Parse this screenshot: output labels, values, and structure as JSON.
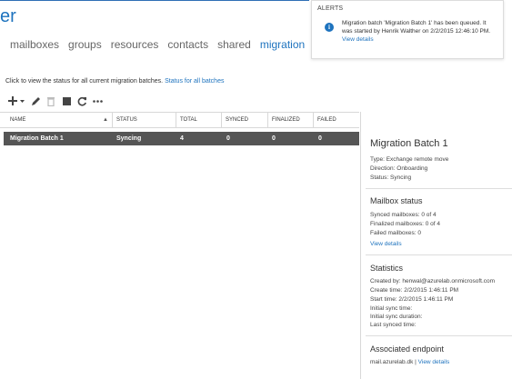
{
  "app": {
    "title": "er"
  },
  "nav": {
    "items": [
      {
        "label": "mailboxes",
        "active": false
      },
      {
        "label": "groups",
        "active": false
      },
      {
        "label": "resources",
        "active": false
      },
      {
        "label": "contacts",
        "active": false
      },
      {
        "label": "shared",
        "active": false
      },
      {
        "label": "migration",
        "active": true
      }
    ]
  },
  "alerts": {
    "title": "ALERTS",
    "message": "Migration batch 'Migration Batch 1' has been queued. It was started by Henrik Walther on 2/2/2015 12:46:10 PM.",
    "link": "View details",
    "icon": "info-icon"
  },
  "instruction": {
    "text": "Click to view the status for all current migration batches.",
    "link": "Status for all batches"
  },
  "toolbar": {
    "buttons": [
      {
        "name": "add-icon",
        "label": "New"
      },
      {
        "name": "edit-icon",
        "label": "Edit"
      },
      {
        "name": "delete-icon",
        "label": "Delete"
      },
      {
        "name": "stop-icon",
        "label": "Stop"
      },
      {
        "name": "refresh-icon",
        "label": "Refresh"
      },
      {
        "name": "more-icon",
        "label": "More options"
      }
    ]
  },
  "grid": {
    "columns": [
      "NAME",
      "STATUS",
      "TOTAL",
      "SYNCED",
      "FINALIZED",
      "FAILED"
    ],
    "sort_column": "NAME",
    "sort_direction": "ascending",
    "rows": [
      {
        "name": "Migration Batch 1",
        "status": "Syncing",
        "total": "4",
        "synced": "0",
        "finalized": "0",
        "failed": "0"
      }
    ]
  },
  "details": {
    "title": "Migration Batch 1",
    "type": "Type: Exchange remote move",
    "direction": "Direction: Onboarding",
    "status": "Status: Syncing",
    "mailbox_status": {
      "heading": "Mailbox status",
      "synced": "Synced mailboxes: 0 of 4",
      "finalized": "Finalized mailboxes: 0 of 4",
      "failed": "Failed mailboxes: 0",
      "link": "View details"
    },
    "statistics": {
      "heading": "Statistics",
      "created_by": "Created by: henwal@azurelab.onmicrosoft.com",
      "create_time": "Create time: 2/2/2015 1:46:11 PM",
      "start_time": "Start time: 2/2/2015 1:46:11 PM",
      "initial_sync_time": "Initial sync time:",
      "initial_sync_duration": "Initial sync duration:",
      "last_synced_time": "Last synced time:"
    },
    "endpoint": {
      "heading": "Associated endpoint",
      "value": "mail.azurelab.dk",
      "separator": "|",
      "link": "View details"
    }
  },
  "colors": {
    "accent": "#1e73be",
    "selected_row": "#555555",
    "border": "#d8d8d8"
  }
}
